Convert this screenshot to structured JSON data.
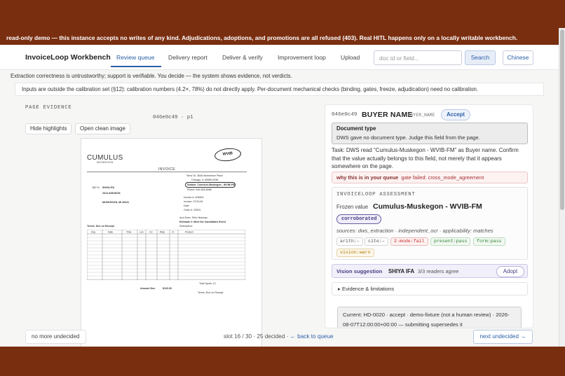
{
  "banner": "read-only demo — this instance accepts no writes of any kind. Adjudications, adoptions, and promotions are all refused (403). Real HITL happens only on a locally writable workbench.",
  "header": {
    "brand": "InvoiceLoop Workbench",
    "tabs": [
      "Review queue",
      "Delivery report",
      "Deliver & verify",
      "Improvement loop",
      "Upload"
    ],
    "active_tab": "Review queue",
    "search_placeholder": "doc id or field...",
    "search_button": "Search",
    "lang_button": "Chinese"
  },
  "notices": {
    "line1": "Extraction correctness is untrustworthy; support is verifiable. You decide — the system shows evidence, not verdicts.",
    "line2": "Inputs are outside the calibration set (§12): calibration numbers (4.2×, 78%) do not directly apply. Per-document mechanical checks (binding, gates, freeze, adjudication) need no calibration."
  },
  "page_evidence": {
    "heading": "PAGE EVIDENCE",
    "page_id": "046e0c49 · p1",
    "hide_highlights": "Hide highlights",
    "open_clean": "Open clean image"
  },
  "document": {
    "logo": "CUMULUS",
    "logo_sub": "MUSKEGON",
    "stamp": "WVIB",
    "title": "INVOICE",
    "bill_to_label": "Bill To:",
    "bill_to": [
      "SHIYA IFA",
      "2013 ADDISON",
      "MUSKEGON, MI 49441"
    ],
    "right_block": [
      "Send To: 3646 Momentum Place",
      "Chicago, IL 60689-5336",
      "Station: Cumulus-Muskegon - WVIB-FM",
      "Phone: 616-655-8966",
      "Invoice #: 494804",
      "Invoice: 07/31/18",
      "Date",
      "Order #: 33523",
      "Acct Exec: Rick Hickman",
      "Estimate #: Meet the Candidates Event",
      "Description:"
    ],
    "terms": "Terms: Due on Receipt",
    "table_headers": [
      "Day",
      "Date",
      "Time",
      "Len",
      "Cd",
      "Rate",
      "CI",
      "Product"
    ],
    "total_label": "Total Spots: 12",
    "amount_label": "Amount Due",
    "amount": "$120.00",
    "footer_terms": "Terms: Due on Receipt"
  },
  "bottom": {
    "no_more": "no more undecided",
    "slot": "slot 16 / 30 · 25 decided · ",
    "back": "← back to queue",
    "next": "next undecided →"
  },
  "panel": {
    "field_id": "046e0c49",
    "field_name": "BUYER NAME",
    "field_code": "BUYER_NAME",
    "accept": "Accept",
    "doctype_heading": "Document type",
    "doctype_text": "DWS gave no document type. Judge this field from the page.",
    "task": "Task: DWS read “Cumulus-Muskegon - WVIB-FM” as Buyer name. Confirm that the value actually belongs to this field, not merely that it appears somewhere on the page.",
    "why_label": "why this is in your queue",
    "why_reason": "gate failed: cross_mode_agreement",
    "assessment_heading": "INVOICELOOP ASSESSMENT",
    "frozen_label": "Frozen value",
    "frozen_value": "Cumulus-Muskegon - WVIB-FM",
    "status_pill": "corroborated",
    "sources": "sources: dws_extraction · independent_ocr · applicability: matches",
    "chips": [
      "arith:–",
      "cite:–",
      "2-mode:fail",
      "present:pass",
      "form:pass",
      "vision:warn"
    ],
    "vision_label": "Vision suggestion",
    "vision_value": "SHIYA IFA",
    "vision_agree": "3/3 readers agree",
    "adopt": "Adopt",
    "evidence": "▸  Evidence & limitations",
    "current": "Current: HD-0020 · accept · demo-fixture (not a human review) · 2026-08-07T12:00:00+00:00 — submitting supersedes it"
  },
  "colors": {
    "frame": "#7a2e10",
    "accent": "#2b5fa8",
    "pass": "#2e7d32",
    "fail": "#c62828",
    "warn": "#b07700",
    "purple": "#4a3d85"
  }
}
